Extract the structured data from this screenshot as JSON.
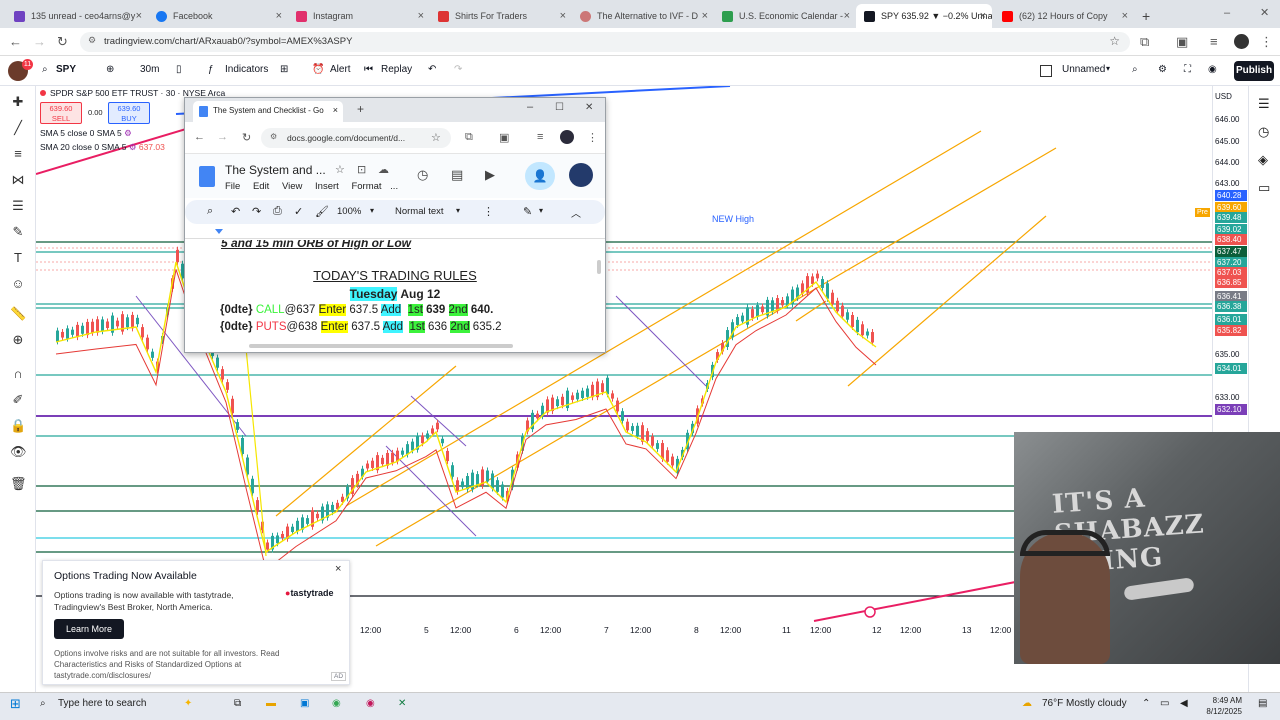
{
  "browser": {
    "tabs": [
      {
        "title": "135 unread - ceo4arns@y",
        "color": "#6f42c1"
      },
      {
        "title": "Facebook",
        "color": "#1877f2"
      },
      {
        "title": "Instagram",
        "color": "#e1306c"
      },
      {
        "title": "Shirts For Traders",
        "color": "#d33"
      },
      {
        "title": "The Alternative to IVF - D",
        "color": "#c77"
      },
      {
        "title": "U.S. Economic Calendar -",
        "color": "#2e9e4f"
      },
      {
        "title": "SPY 635.92 ▼ −0.2% Unna",
        "color": "#131722"
      },
      {
        "title": "(62) 12 Hours of Copy",
        "color": "#ff0000"
      }
    ],
    "new_tab": "+",
    "url": "tradingview.com/chart/ARxauab0/?symbol=AMEX%3ASPY"
  },
  "tv_toolbar": {
    "symbol": "SPY",
    "interval": "30m",
    "indicators": "Indicators",
    "alert": "Alert",
    "replay": "Replay",
    "layout_name": "Unnamed",
    "publish": "Publish",
    "notif_count": "11"
  },
  "legend": {
    "symbol_line": "SPDR S&P 500 ETF TRUST · 30 · NYSE Arca",
    "sell_price": "639.60",
    "sell_label": "SELL",
    "spread": "0.00",
    "buy_price": "639.60",
    "buy_label": "BUY",
    "sma5": "SMA 5 close 0 SMA 5",
    "sma20": "SMA 20 close 0 SMA 5",
    "sma20_value": "637.03"
  },
  "chart_annotations": {
    "new_high": "NEW High",
    "pre_label": "Pre"
  },
  "price_axis": {
    "currency": "USD",
    "ticks": [
      "646.00",
      "645.00",
      "644.00",
      "643.00",
      "635.00",
      "633.00"
    ],
    "tags": [
      {
        "value": "640.28",
        "color": "#2962ff"
      },
      {
        "value": "639.60",
        "color": "#f7a600"
      },
      {
        "value": "639.48",
        "color": "#26a69a"
      },
      {
        "value": "639.02",
        "color": "#26a69a"
      },
      {
        "value": "638.40",
        "color": "#ef5350"
      },
      {
        "value": "637.47",
        "color": "#0c5e3a"
      },
      {
        "value": "637.20",
        "color": "#26a69a"
      },
      {
        "value": "637.03",
        "color": "#ef5350"
      },
      {
        "value": "636.85",
        "color": "#ef5350"
      },
      {
        "value": "636.41",
        "color": "#787b86"
      },
      {
        "value": "636.38",
        "color": "#26a69a"
      },
      {
        "value": "636.01",
        "color": "#26a69a"
      },
      {
        "value": "635.82",
        "color": "#ef5350"
      },
      {
        "value": "634.01",
        "color": "#26a69a"
      },
      {
        "value": "632.10",
        "color": "#7b3fb8"
      }
    ]
  },
  "time_axis": [
    "12:00",
    "5",
    "12:00",
    "6",
    "12:00",
    "7",
    "12:00",
    "8",
    "12:00",
    "11",
    "12:00",
    "12",
    "12:00",
    "13",
    "12:00"
  ],
  "docs": {
    "tab_title": "The System and Checklist - Go",
    "url": "docs.google.com/document/d...",
    "doc_title": "The System and ...",
    "menu": [
      "File",
      "Edit",
      "View",
      "Insert",
      "Format",
      "..."
    ],
    "zoom": "100%",
    "style": "Normal text",
    "partial_heading": "5 and 15 min ORB of High or Low",
    "rules_title": "TODAY'S TRADING RULES",
    "day": "Tuesday",
    "date": "Aug 12",
    "call_line": {
      "prefix": "{0dte}",
      "kind": "CALL",
      "at": "@637",
      "enter_label": "Enter",
      "enter": "637.5",
      "add": "Add",
      "first_label": "1st",
      "first": "639",
      "second_label": "2nd",
      "second": "640."
    },
    "put_line": {
      "prefix": "{0dte}",
      "kind": "PUTS",
      "at": "@638",
      "enter_label": "Enter",
      "enter": "637.5",
      "add": "Add",
      "first_label": "1st",
      "first": "636",
      "second_label": "2nd",
      "second": "635.2"
    }
  },
  "ad": {
    "title": "Options Trading Now Available",
    "brand": "tastytrade",
    "body": "Options trading is now available with tastytrade, Tradingview's Best Broker, North America.",
    "cta": "Learn More",
    "disclaimer": "Options involve risks and are not suitable for all investors. Read Characteristics and Risks of Standardized Options at tastytrade.com/disclosures/",
    "ad_tag": "AD"
  },
  "webcam": {
    "banner": "IT'S A SHABAZZ THING"
  },
  "taskbar": {
    "search": "Type here to search",
    "weather": "76°F  Mostly cloudy",
    "time": "8:49 AM",
    "date": "8/12/2025"
  }
}
